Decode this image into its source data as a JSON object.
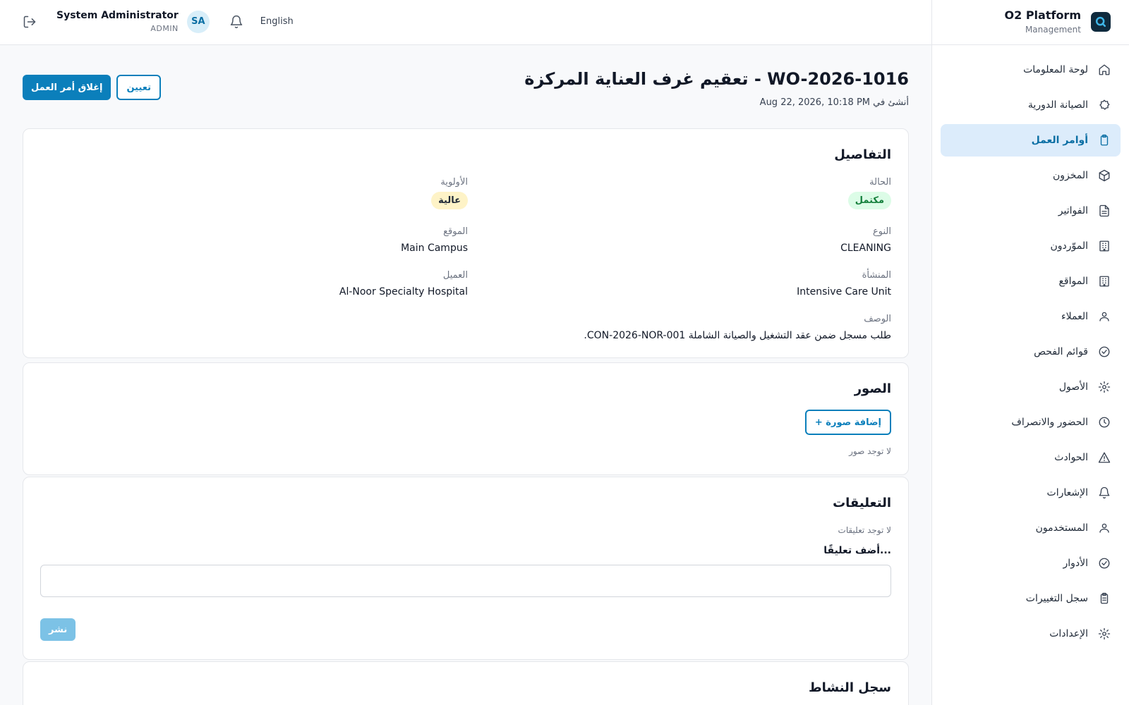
{
  "app": {
    "brand_title": "O2 Platform",
    "brand_subtitle": "Management"
  },
  "topbar": {
    "user_name": "System Administrator",
    "user_role": "ADMIN",
    "avatar_initials": "SA",
    "language": "English"
  },
  "sidebar": {
    "items": [
      {
        "label": "لوحة المعلومات",
        "icon": "home-icon"
      },
      {
        "label": "الصيانة الدورية",
        "icon": "maintenance-icon"
      },
      {
        "label": "أوامر العمل",
        "icon": "clipboard-icon",
        "active": true
      },
      {
        "label": "المخزون",
        "icon": "box-icon"
      },
      {
        "label": "الفواتير",
        "icon": "document-icon"
      },
      {
        "label": "الموّردون",
        "icon": "building-icon"
      },
      {
        "label": "المواقع",
        "icon": "building-icon"
      },
      {
        "label": "العملاء",
        "icon": "users-icon"
      },
      {
        "label": "قوائم الفحص",
        "icon": "check-circle-icon"
      },
      {
        "label": "الأصول",
        "icon": "gear-icon"
      },
      {
        "label": "الحضور والانصراف",
        "icon": "clock-icon"
      },
      {
        "label": "الحوادث",
        "icon": "warning-icon"
      },
      {
        "label": "الإشعارات",
        "icon": "bell-icon"
      },
      {
        "label": "المستخدمون",
        "icon": "users-icon"
      },
      {
        "label": "الأدوار",
        "icon": "check-circle-icon"
      },
      {
        "label": "سجل التغييرات",
        "icon": "clipboard-list-icon"
      },
      {
        "label": "الإعدادات",
        "icon": "gear-icon"
      }
    ]
  },
  "page": {
    "title": "WO-2026-1016 - تعقيم غرف العناية المركزة",
    "created_label": "أنشئ في",
    "created_at": "Aug 22, 2026, 10:18 PM",
    "close_button": "إغلاق أمر العمل",
    "assign_button": "تعيين"
  },
  "details": {
    "heading": "التفاصيل",
    "status_label": "الحالة",
    "status_value": "مكتمل",
    "priority_label": "الأولوية",
    "priority_value": "عالية",
    "type_label": "النوع",
    "type_value": "CLEANING",
    "location_label": "الموقع",
    "location_value": "Main Campus",
    "facility_label": "المنشأة",
    "facility_value": "Intensive Care Unit",
    "client_label": "العميل",
    "client_value": "Al-Noor Specialty Hospital",
    "description_label": "الوصف",
    "description_value": "طلب مسجل ضمن عقد التشغيل والصيانة الشاملة CON-2026-NOR-001."
  },
  "photos": {
    "heading": "الصور",
    "add_button": "+ إضافة صورة",
    "empty_text": "لا توجد صور"
  },
  "comments": {
    "heading": "التعليقات",
    "empty_text": "لا توجد تعليقات",
    "input_label": "أضف تعليقًا...",
    "post_button": "نشر"
  },
  "activity": {
    "heading": "سجل النشاط"
  },
  "colors": {
    "primary": "#0b7fbb",
    "active_nav_bg": "#dcecfb",
    "status_badge_bg": "#dcfce7",
    "priority_badge_bg": "#fef3c7"
  }
}
